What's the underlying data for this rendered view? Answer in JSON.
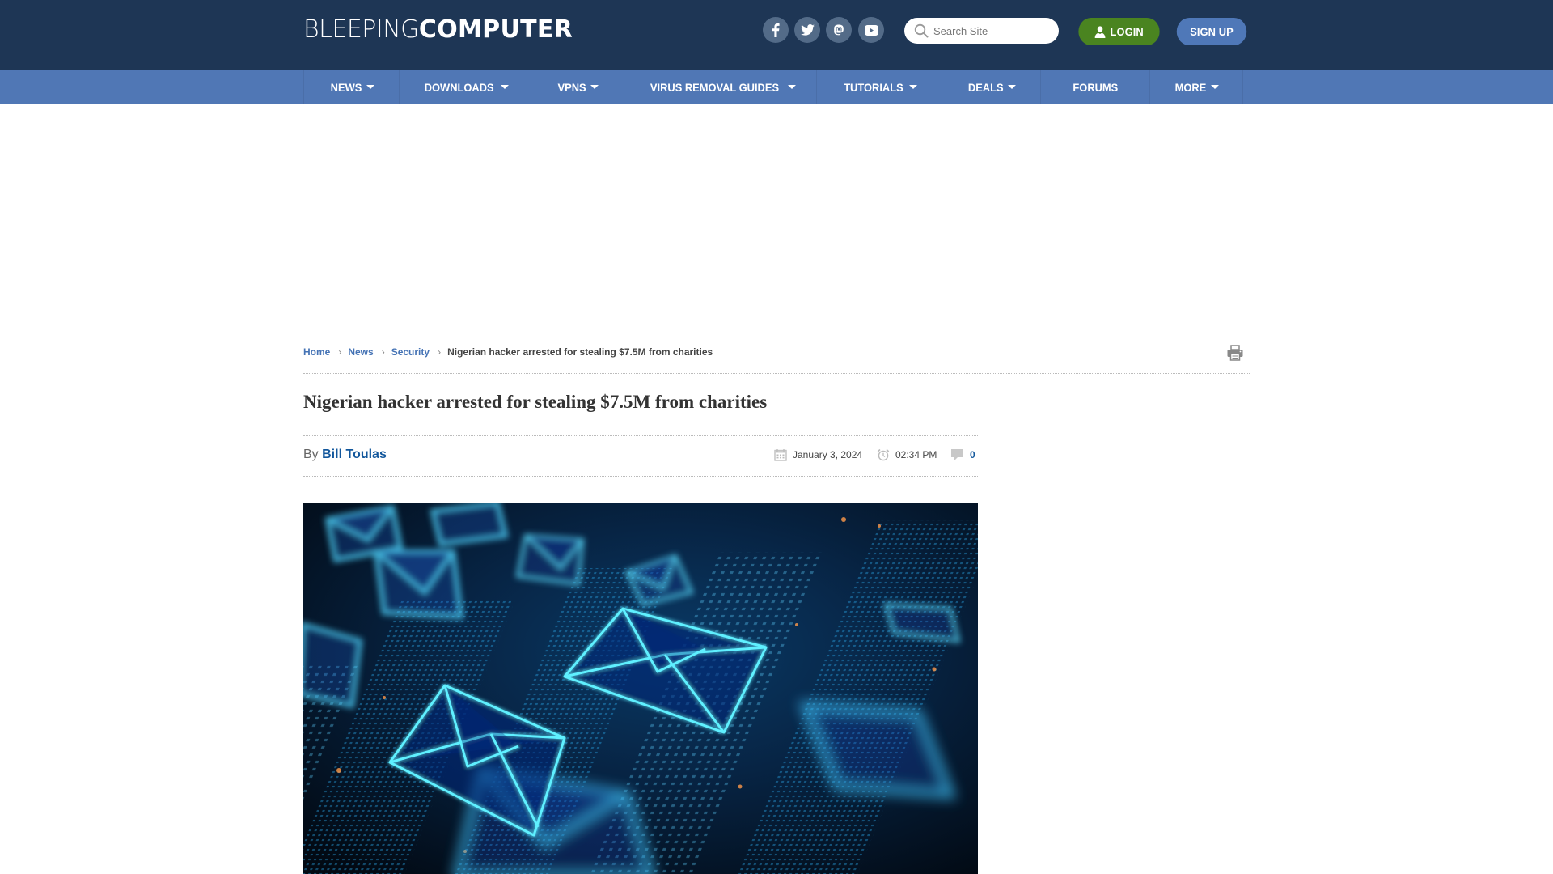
{
  "header": {
    "logo_light": "BLEEPING",
    "logo_bold": "COMPUTER",
    "social": [
      {
        "name": "facebook",
        "icon": "facebook-icon"
      },
      {
        "name": "twitter",
        "icon": "twitter-icon"
      },
      {
        "name": "mastodon",
        "icon": "mastodon-icon"
      },
      {
        "name": "youtube",
        "icon": "youtube-icon"
      }
    ],
    "search_placeholder": "Search Site",
    "login_label": "LOGIN",
    "signup_label": "SIGN UP"
  },
  "nav": {
    "items": [
      {
        "label": "NEWS",
        "dropdown": true
      },
      {
        "label": "DOWNLOADS",
        "dropdown": true
      },
      {
        "label": "VPNS",
        "dropdown": true
      },
      {
        "label": "VIRUS REMOVAL GUIDES",
        "dropdown": true
      },
      {
        "label": "TUTORIALS",
        "dropdown": true
      },
      {
        "label": "DEALS",
        "dropdown": true
      },
      {
        "label": "FORUMS",
        "dropdown": false
      },
      {
        "label": "MORE",
        "dropdown": true
      }
    ]
  },
  "breadcrumb": {
    "items": [
      "Home",
      "News",
      "Security"
    ],
    "current": "Nigerian hacker arrested for stealing $7.5M from charities"
  },
  "article": {
    "title": "Nigerian hacker arrested for stealing $7.5M from charities",
    "by_prefix": "By",
    "author": "Bill Toulas",
    "date": "January 3, 2024",
    "time": "02:34 PM",
    "comments": "0",
    "image_alt": "Glowing email envelope icons over a digital circuit background"
  },
  "colors": {
    "header_bg": "#1e3655",
    "nav_bg": "#5077b5",
    "login_bg": "#4a8420",
    "signup_bg": "#4f78b8",
    "link": "#12579c"
  }
}
